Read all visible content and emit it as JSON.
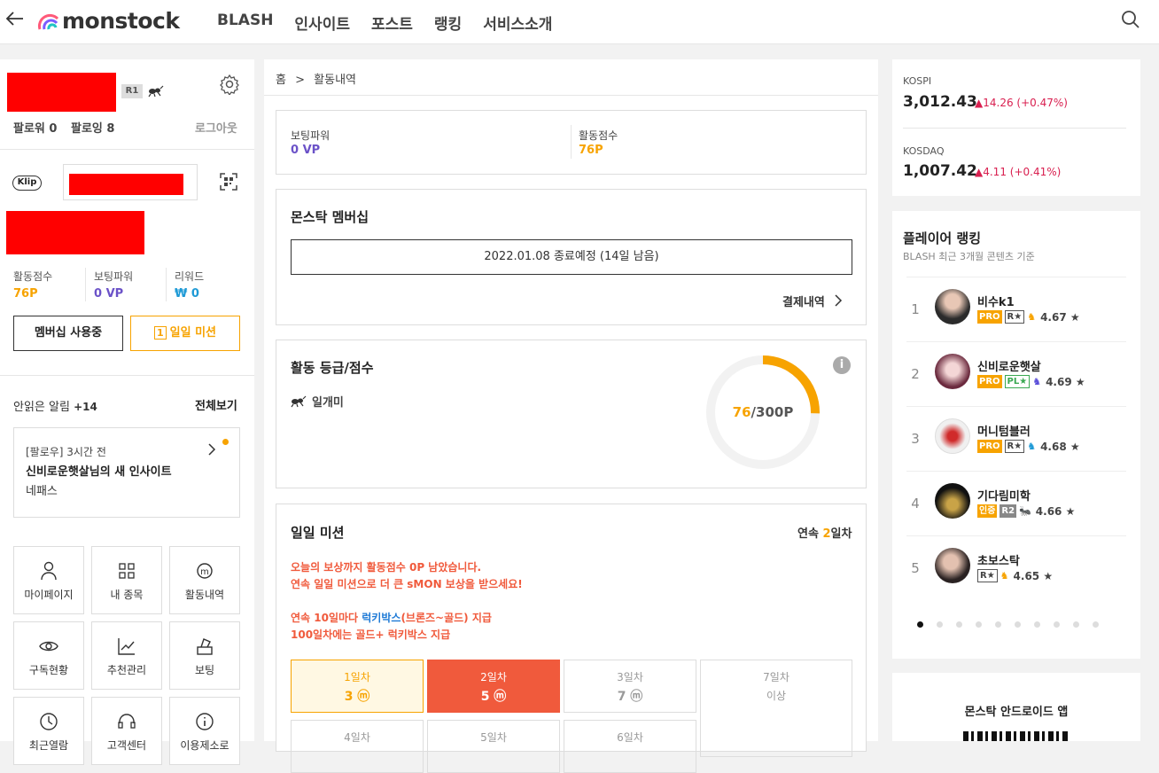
{
  "nav": {
    "logo_text": "monstock",
    "items": [
      "BLASH",
      "인사이트",
      "포스트",
      "랭킹",
      "서비스소개"
    ]
  },
  "profile": {
    "rank_badge": "R1",
    "follower_label": "팔로워",
    "follower_count": "0",
    "following_label": "팔로잉",
    "following_count": "8",
    "logout": "로그아웃",
    "klip": "Klip",
    "stats": [
      {
        "label": "활동점수",
        "value": "76P",
        "color": "#f7a300"
      },
      {
        "label": "보팅파워",
        "value": "0 VP",
        "color": "#6b52c8"
      },
      {
        "label": "리워드",
        "value": "₩ 0",
        "color": "#1e9ad6"
      }
    ],
    "membership_button": "멤버십 사용중",
    "daily_button": "일일 미션"
  },
  "notifications": {
    "title": "안읽은 알림",
    "count": "+14",
    "view_all": "전체보기",
    "item": {
      "meta": "[팔로우] 3시간 전",
      "title": "신비로운햇살님의 새 인사이트",
      "subtitle": "네패스"
    }
  },
  "menu_tiles": [
    {
      "label": "마이페이지",
      "icon": "person-icon"
    },
    {
      "label": "내 종목",
      "icon": "grid-icon"
    },
    {
      "label": "활동내역",
      "icon": "m-coin-icon"
    },
    {
      "label": "구독현황",
      "icon": "eye-icon"
    },
    {
      "label": "추천관리",
      "icon": "chart-icon"
    },
    {
      "label": "보팅",
      "icon": "vote-icon"
    },
    {
      "label": "최근열람",
      "icon": "clock-icon"
    },
    {
      "label": "고객센터",
      "icon": "headset-icon"
    },
    {
      "label": "이용제소로",
      "icon": "info-icon"
    }
  ],
  "breadcrumb": {
    "home": "홈",
    "sep": ">",
    "current": "활동내역"
  },
  "summary": {
    "voting_label": "보팅파워",
    "voting_value": "0 VP",
    "activity_label": "활동점수",
    "activity_value": "76P"
  },
  "membership": {
    "title": "몬스탁 멤버십",
    "expiry": "2022.01.08 종료예정 (14일 남음)",
    "payment_history": "결제내역"
  },
  "grade": {
    "title": "활동 등급/점수",
    "level_name": "일개미",
    "score": "76",
    "max": "/300P",
    "progress": 0.2533
  },
  "daily_mission": {
    "title": "일일 미션",
    "streak_prefix": "연속",
    "streak_value": "2",
    "streak_suffix": "일차",
    "notice_line1": "오늘의 보상까지 활동점수 0P 남았습니다.",
    "notice_line2": "연속 일일 미션으로 더 큰 sMON 보상을 받으세요!",
    "notice_line3_pre": "연속 10일마다",
    "notice_line3_link": "럭키박스",
    "notice_line3_post": "(브론즈~골드) 지급",
    "notice_line4": "100일차에는 골드+ 럭키박스 지급",
    "days": [
      {
        "label": "1일차",
        "reward": "3"
      },
      {
        "label": "2일차",
        "reward": "5"
      },
      {
        "label": "3일차",
        "reward": "7"
      },
      {
        "label": "7일차",
        "reward": "이상"
      },
      {
        "label": "4일차",
        "reward": ""
      },
      {
        "label": "5일차",
        "reward": ""
      },
      {
        "label": "6일차",
        "reward": ""
      }
    ]
  },
  "market": {
    "kospi_label": "KOSPI",
    "kospi_value": "3,012.43",
    "kospi_change": "▲14.26 (+0.47%)",
    "kosdaq_label": "KOSDAQ",
    "kosdaq_value": "1,007.42",
    "kosdaq_change": "▲4.11 (+0.41%)"
  },
  "ranking": {
    "title": "플레이어 랭킹",
    "subtitle": "BLASH 최근 3개월 콘텐츠 기준",
    "players": [
      {
        "rank": "1",
        "name": "비수k1",
        "tags": [
          "PRO",
          "R★"
        ],
        "score": "4.67 ★"
      },
      {
        "rank": "2",
        "name": "신비로운햇살",
        "tags": [
          "PRO",
          "PL★"
        ],
        "score": "4.69 ★"
      },
      {
        "rank": "3",
        "name": "머니텀블러",
        "tags": [
          "PRO",
          "R★"
        ],
        "score": "4.68 ★"
      },
      {
        "rank": "4",
        "name": "기다림미학",
        "tags": [
          "인증",
          "R2"
        ],
        "score": "4.66 ★"
      },
      {
        "rank": "5",
        "name": "초보스탁",
        "tags": [
          "R★"
        ],
        "score": "4.65 ★"
      }
    ]
  },
  "app_promo": {
    "title": "몬스탁 안드로이드 앱"
  }
}
